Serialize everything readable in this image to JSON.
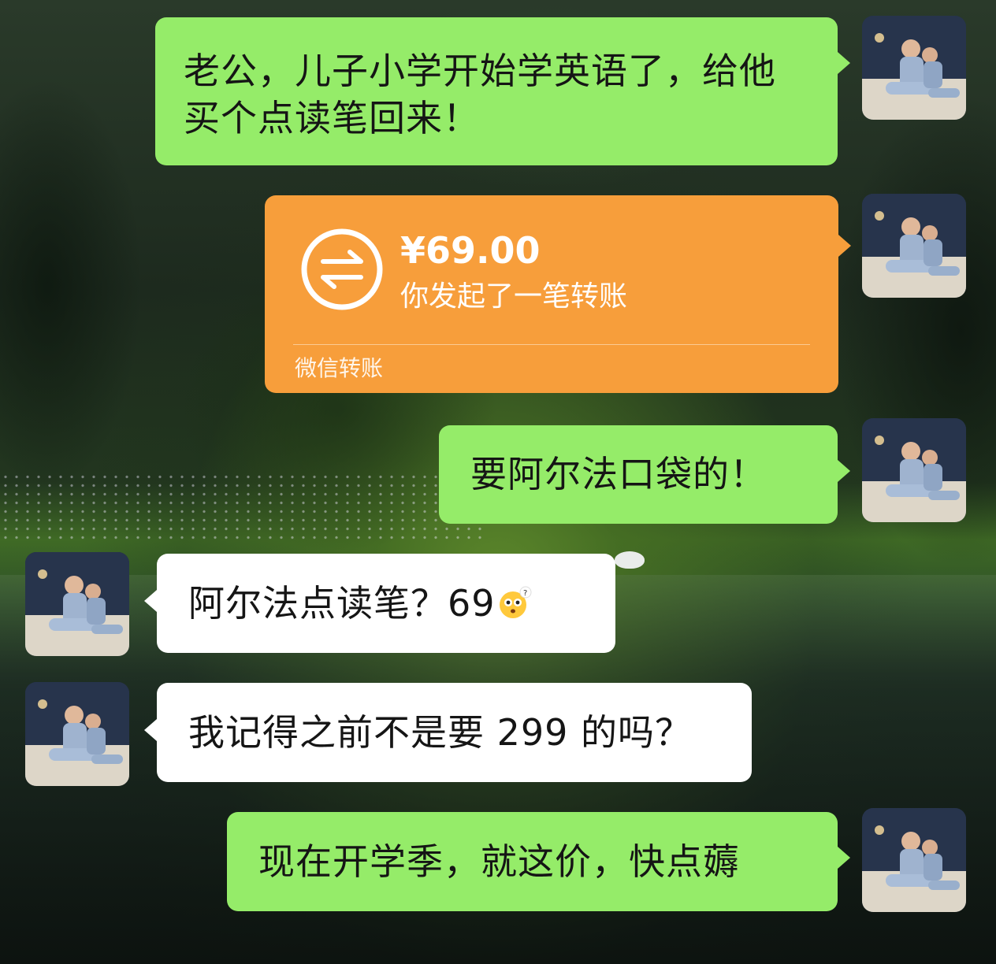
{
  "chat": {
    "messages": [
      {
        "sender": "self",
        "type": "text",
        "text": "老公，儿子小学开始学英语了，给他买个点读笔回来！"
      },
      {
        "sender": "self",
        "type": "transfer",
        "amount": "¥69.00",
        "description": "你发起了一笔转账",
        "footer": "微信转账"
      },
      {
        "sender": "self",
        "type": "text",
        "text": "要阿尔法口袋的！"
      },
      {
        "sender": "other",
        "type": "text",
        "text": "阿尔法点读笔？69",
        "emoji": "flushed-question-emoji"
      },
      {
        "sender": "other",
        "type": "text",
        "text": "我记得之前不是要 299 的吗？"
      },
      {
        "sender": "self",
        "type": "text",
        "text": "现在开学季，就这价，快点薅"
      }
    ]
  },
  "colors": {
    "self_bubble": "#95ec69",
    "other_bubble": "#ffffff",
    "transfer_card": "#f79e3b"
  }
}
